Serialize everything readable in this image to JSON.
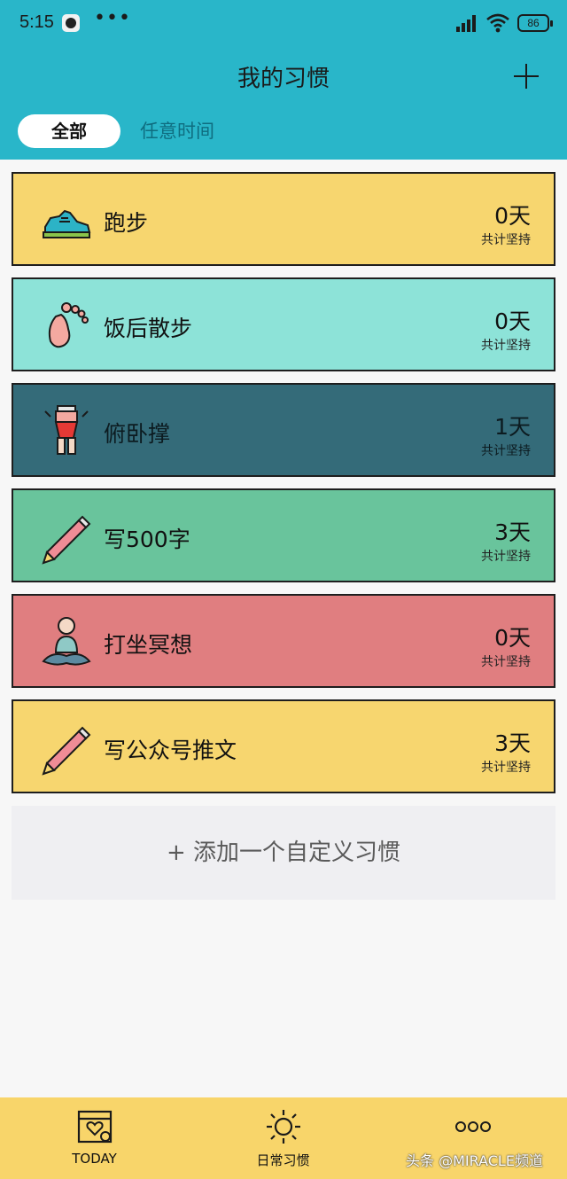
{
  "status_bar": {
    "time": "5:15",
    "battery": "86"
  },
  "header": {
    "title": "我的习惯",
    "add_icon": "plus-icon"
  },
  "tabs": [
    {
      "label": "全部",
      "selected": true
    },
    {
      "label": "任意时间",
      "selected": false
    }
  ],
  "habits": [
    {
      "name": "跑步",
      "days": "0天",
      "caption": "共计坚持",
      "color": "#f7d66f",
      "icon": "sneaker-icon"
    },
    {
      "name": "饭后散步",
      "days": "0天",
      "caption": "共计坚持",
      "color": "#8de3d8",
      "icon": "footprint-icon"
    },
    {
      "name": "俯卧撑",
      "days": "1天",
      "caption": "共计坚持",
      "color": "#346b79",
      "icon": "pushup-icon"
    },
    {
      "name": "写500字",
      "days": "3天",
      "caption": "共计坚持",
      "color": "#69c49c",
      "icon": "pencil-icon"
    },
    {
      "name": "打坐冥想",
      "days": "0天",
      "caption": "共计坚持",
      "color": "#e07e80",
      "icon": "meditation-icon"
    },
    {
      "name": "写公众号推文",
      "days": "3天",
      "caption": "共计坚持",
      "color": "#f7d66f",
      "icon": "pencil-icon"
    }
  ],
  "add_custom": {
    "label": "+ 添加一个自定义习惯"
  },
  "bottom_nav": [
    {
      "label": "TODAY",
      "icon": "calendar-heart-icon"
    },
    {
      "label": "日常习惯",
      "icon": "sun-icon"
    },
    {
      "label": "",
      "icon": "more-icon"
    }
  ],
  "watermark": "头条 @MIRACLE频道"
}
